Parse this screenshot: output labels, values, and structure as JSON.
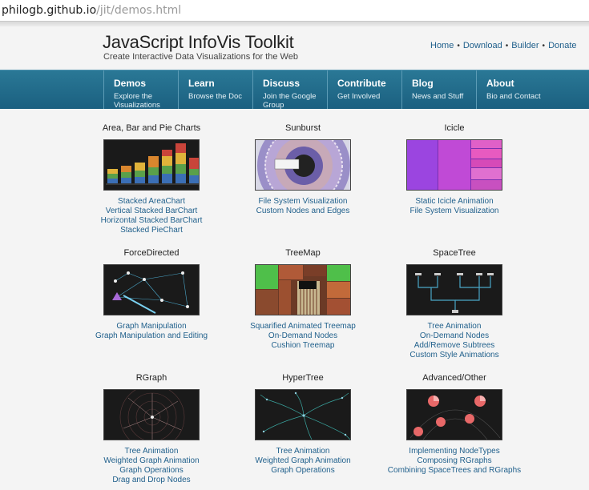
{
  "browser": {
    "url_host": "philogb.github.io",
    "url_path": "/jit/demos.html"
  },
  "header": {
    "title": "JavaScript InfoVis Toolkit",
    "subtitle": "Create Interactive Data Visualizations for the Web",
    "links": [
      "Home",
      "Download",
      "Builder",
      "Donate"
    ]
  },
  "nav": [
    {
      "title": "Demos",
      "sub": "Explore the Visualizations"
    },
    {
      "title": "Learn",
      "sub": "Browse the Doc"
    },
    {
      "title": "Discuss",
      "sub": "Join the Google Group"
    },
    {
      "title": "Contribute",
      "sub": "Get Involved"
    },
    {
      "title": "Blog",
      "sub": "News and Stuff"
    },
    {
      "title": "About",
      "sub": "Bio and Contact"
    }
  ],
  "sections": [
    {
      "title": "Area, Bar and Pie Charts",
      "links": [
        "Stacked AreaChart",
        "Vertical Stacked BarChart",
        "Horizontal Stacked BarChart",
        "Stacked PieChart"
      ]
    },
    {
      "title": "Sunburst",
      "links": [
        "File System Visualization",
        "Custom Nodes and Edges"
      ]
    },
    {
      "title": "Icicle",
      "links": [
        "Static Icicle Animation",
        "File System Visualization"
      ]
    },
    {
      "title": "ForceDirected",
      "links": [
        "Graph Manipulation",
        "Graph Manipulation and Editing"
      ]
    },
    {
      "title": "TreeMap",
      "links": [
        "Squarified Animated Treemap",
        "On-Demand Nodes",
        "Cushion Treemap"
      ]
    },
    {
      "title": "SpaceTree",
      "links": [
        "Tree Animation",
        "On-Demand Nodes",
        "Add/Remove Subtrees",
        "Custom Style Animations"
      ]
    },
    {
      "title": "RGraph",
      "links": [
        "Tree Animation",
        "Weighted Graph Animation",
        "Graph Operations",
        "Drag and Drop Nodes"
      ]
    },
    {
      "title": "HyperTree",
      "links": [
        "Tree Animation",
        "Weighted Graph Animation",
        "Graph Operations"
      ]
    },
    {
      "title": "Advanced/Other",
      "links": [
        "Implementing NodeTypes",
        "Composing RGraphs",
        "Combining SpaceTrees and RGraphs"
      ]
    }
  ]
}
